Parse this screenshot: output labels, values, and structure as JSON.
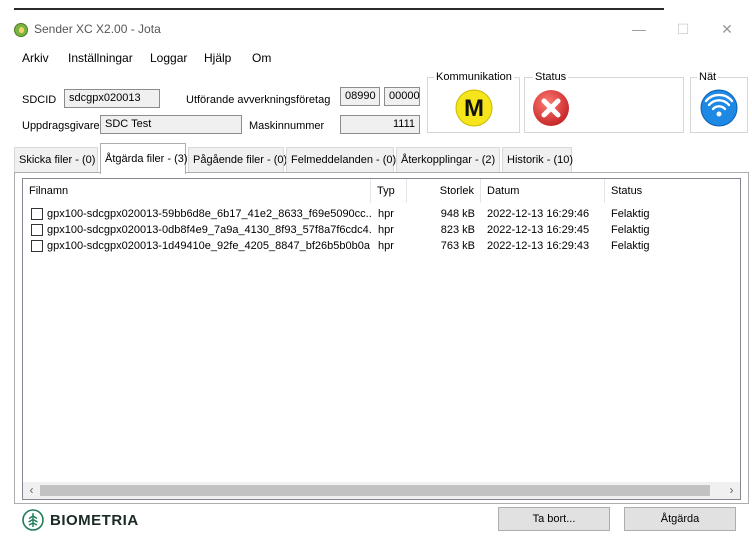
{
  "window": {
    "title": "Sender XC X2.00 - Jota",
    "minimize_glyph": "—",
    "maximize_glyph": "☐",
    "close_glyph": "✕"
  },
  "menu": {
    "items": [
      "Arkiv",
      "Inställningar",
      "Loggar",
      "Hjälp",
      "Om"
    ]
  },
  "info": {
    "sdcid_label": "SDCID",
    "sdcid_value": "sdcgpx020013",
    "uppdragsgivare_label": "Uppdragsgivare",
    "uppdragsgivare_value": "SDC Test",
    "utforande_label": "Utförande avverkningsföretag",
    "utforande_value1": "08990",
    "utforande_value2": "00000",
    "maskinnummer_label": "Maskinnummer",
    "maskinnummer_value": "1111"
  },
  "indicators": {
    "kommunikation_label": "Kommunikation",
    "kommunikation_letter": "M",
    "status_label": "Status",
    "nat_label": "Nät",
    "colors": {
      "m_yellow": "#f7e51c",
      "status_red": "#e53935",
      "net_blue": "#1e88e5"
    },
    "icons": [
      "m-icon",
      "error-icon",
      "wifi-icon"
    ]
  },
  "tabs": [
    {
      "label": "Skicka filer - (0)",
      "active": false
    },
    {
      "label": "Åtgärda filer - (3)",
      "active": true
    },
    {
      "label": "Pågående filer - (0)",
      "active": false
    },
    {
      "label": "Felmeddelanden - (0)",
      "active": false
    },
    {
      "label": "Återkopplingar - (2)",
      "active": false
    },
    {
      "label": "Historik - (10)",
      "active": false
    }
  ],
  "table": {
    "columns": [
      "Filnamn",
      "Typ",
      "Storlek",
      "Datum",
      "Status"
    ],
    "rows": [
      {
        "filename": "gpx100-sdcgpx020013-59bb6d8e_6b17_41e2_8633_f69e5090cc...",
        "type": "hpr",
        "size": "948 kB",
        "date": "2022-12-13 16:29:46",
        "status": "Felaktig"
      },
      {
        "filename": "gpx100-sdcgpx020013-0db8f4e9_7a9a_4130_8f93_57f8a7f6cdc4...",
        "type": "hpr",
        "size": "823 kB",
        "date": "2022-12-13 16:29:45",
        "status": "Felaktig"
      },
      {
        "filename": "gpx100-sdcgpx020013-1d49410e_92fe_4205_8847_bf26b5b0b0a...",
        "type": "hpr",
        "size": "763 kB",
        "date": "2022-12-13 16:29:43",
        "status": "Felaktig"
      }
    ],
    "scroll_left": "‹",
    "scroll_right": "›"
  },
  "footer": {
    "logo_text": "BIOMETRIA",
    "delete_button": "Ta bort...",
    "action_button": "Åtgärda"
  }
}
